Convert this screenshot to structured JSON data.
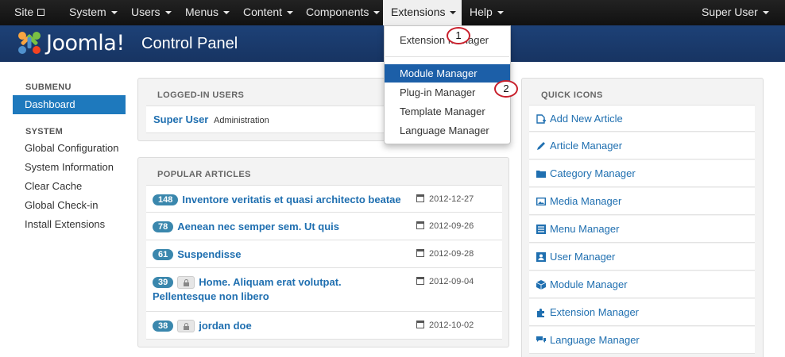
{
  "topnav": {
    "site": "Site",
    "menus": [
      "System",
      "Users",
      "Menus",
      "Content",
      "Components",
      "Extensions",
      "Help"
    ],
    "user": "Super User"
  },
  "header": {
    "logo_text": "Joomla!",
    "title": "Control Panel"
  },
  "sidebar": {
    "submenu_heading": "SUBMENU",
    "active_item": "Dashboard",
    "system_heading": "SYSTEM",
    "items": [
      "Global Configuration",
      "System Information",
      "Clear Cache",
      "Global Check-in",
      "Install Extensions"
    ]
  },
  "logged_in": {
    "heading": "LOGGED-IN USERS",
    "user": "Super User",
    "role": "Administration"
  },
  "popular": {
    "heading": "POPULAR ARTICLES",
    "articles": [
      {
        "hits": "148",
        "title": "Inventore veritatis et quasi architecto beatae",
        "date": "2012-12-27",
        "locked": false
      },
      {
        "hits": "78",
        "title": "Aenean nec semper sem. Ut quis",
        "date": "2012-09-26",
        "locked": false
      },
      {
        "hits": "61",
        "title": "Suspendisse",
        "date": "2012-09-28",
        "locked": false
      },
      {
        "hits": "39",
        "title": "Home. Aliquam erat volutpat.",
        "title_line2": "Pellentesque non libero",
        "date": "2012-09-04",
        "locked": true
      },
      {
        "hits": "38",
        "title": "jordan doe",
        "date": "2012-10-02",
        "locked": true
      }
    ]
  },
  "quick_icons": {
    "heading": "QUICK ICONS",
    "items": [
      {
        "label": "Add New Article",
        "icon": "add-article-icon"
      },
      {
        "label": "Article Manager",
        "icon": "pencil-icon"
      },
      {
        "label": "Category Manager",
        "icon": "folder-icon"
      },
      {
        "label": "Media Manager",
        "icon": "image-icon"
      },
      {
        "label": "Menu Manager",
        "icon": "list-icon"
      },
      {
        "label": "User Manager",
        "icon": "user-icon"
      },
      {
        "label": "Module Manager",
        "icon": "cube-icon"
      },
      {
        "label": "Extension Manager",
        "icon": "puzzle-icon"
      },
      {
        "label": "Language Manager",
        "icon": "comments-icon"
      }
    ]
  },
  "extensions_dropdown": {
    "items": [
      "Extension Manager",
      "Module Manager",
      "Plug-in Manager",
      "Template Manager",
      "Language Manager"
    ],
    "highlighted": "Module Manager"
  },
  "callouts": [
    "1",
    "2"
  ],
  "colors": {
    "nav_bg": "#111111",
    "header_bg": "#1c3d6e",
    "link": "#1f6fb0",
    "active": "#1e79bd",
    "callout": "#c8202c"
  }
}
